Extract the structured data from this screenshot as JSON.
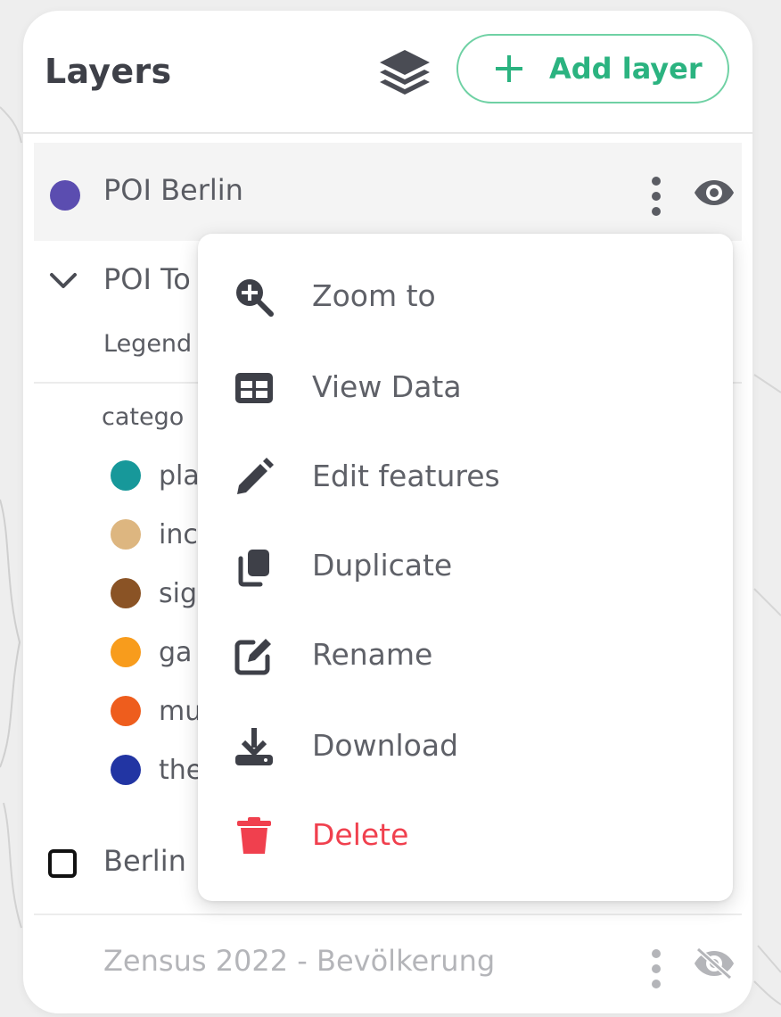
{
  "panel": {
    "title": "Layers",
    "layers_icon": "layers-stack-icon",
    "add_layer_label": "Add layer"
  },
  "layers": {
    "poi_berlin": {
      "name": "POI Berlin",
      "color": "#5b4db0"
    },
    "poi_tourism": {
      "name_visible": "POI To",
      "legend_label_visible": "Legend",
      "category_label_visible": "catego",
      "categories": [
        {
          "label_visible": "pla",
          "color": "#17989a"
        },
        {
          "label_visible": "inc",
          "color": "#ddb680"
        },
        {
          "label_visible": "sig",
          "color": "#8a5325"
        },
        {
          "label_visible": "ga",
          "color": "#f89c1c"
        },
        {
          "label_visible": "mu",
          "color": "#ee5d1d"
        },
        {
          "label_visible": "the",
          "color": "#2235a3"
        }
      ]
    },
    "berlin": {
      "name_visible": "Berlin"
    },
    "zensus": {
      "name": "Zensus 2022 - Bevölkerung"
    }
  },
  "context_menu": {
    "items": [
      {
        "label": "Zoom to",
        "icon": "zoom-in-icon"
      },
      {
        "label": "View Data",
        "icon": "table-icon"
      },
      {
        "label": "Edit features",
        "icon": "pencil-icon"
      },
      {
        "label": "Duplicate",
        "icon": "copy-icon"
      },
      {
        "label": "Rename",
        "icon": "edit-square-icon"
      },
      {
        "label": "Download",
        "icon": "download-icon"
      },
      {
        "label": "Delete",
        "icon": "trash-icon"
      }
    ]
  },
  "colors": {
    "accent_green": "#2bb380",
    "danger_red": "#f0404e",
    "text_gray": "#5a5c63"
  }
}
